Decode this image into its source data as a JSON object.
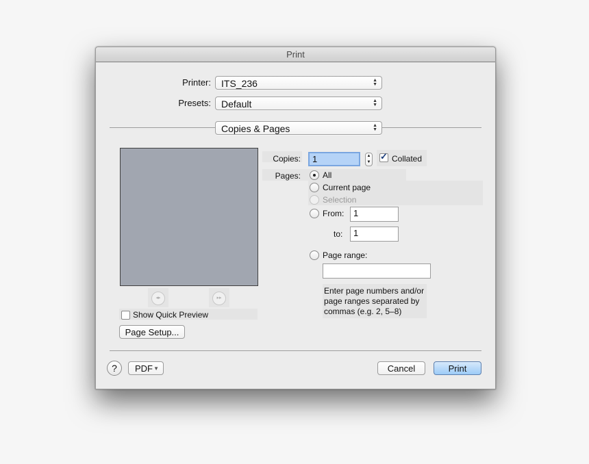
{
  "window": {
    "title": "Print"
  },
  "printer": {
    "label": "Printer:",
    "value": "ITS_236"
  },
  "presets": {
    "label": "Presets:",
    "value": "Default"
  },
  "section": {
    "value": "Copies & Pages"
  },
  "copies": {
    "label": "Copies:",
    "value": "1",
    "collated_label": "Collated",
    "collated_checked": true
  },
  "pages": {
    "label": "Pages:",
    "options": {
      "all": "All",
      "current": "Current page",
      "selection": "Selection",
      "from": "From:",
      "to": "to:",
      "range": "Page range:"
    },
    "selected": "All",
    "from_value": "1",
    "to_value": "1",
    "range_value": "",
    "hint": [
      "Enter page numbers and/or",
      "page ranges separated by",
      "commas (e.g. 2, 5–8)"
    ]
  },
  "preview": {
    "prev_icon": "previous-page-icon",
    "next_icon": "next-page-icon",
    "show_quick_preview_label": "Show Quick Preview",
    "show_quick_preview_checked": false
  },
  "buttons": {
    "page_setup": "Page Setup...",
    "help": "?",
    "pdf": "PDF",
    "cancel": "Cancel",
    "print": "Print"
  }
}
